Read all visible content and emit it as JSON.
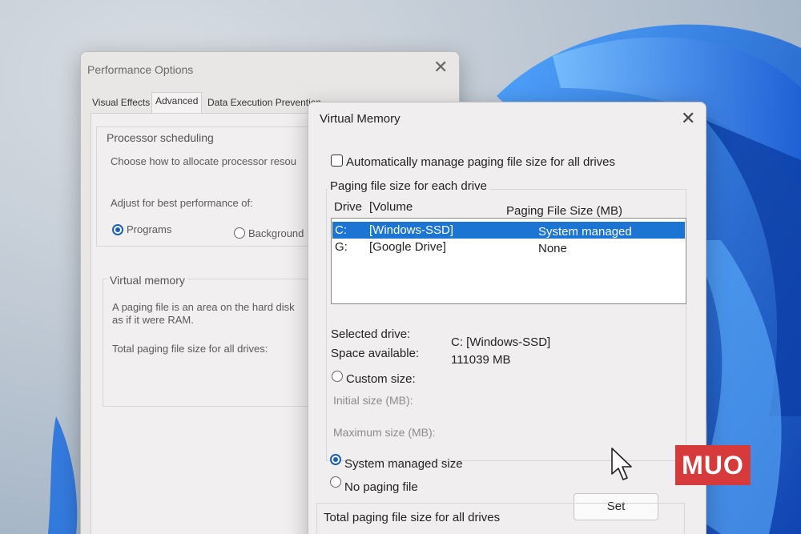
{
  "performance_options": {
    "title": "Performance Options",
    "tabs": [
      "Visual Effects",
      "Advanced",
      "Data Execution Prevention"
    ],
    "processor_scheduling": {
      "label": "Processor scheduling",
      "description": "Choose how to allocate processor resou",
      "adjust_label": "Adjust for best performance of:",
      "options": [
        "Programs",
        "Background"
      ],
      "selected": "Programs"
    },
    "virtual_memory": {
      "label": "Virtual memory",
      "description_line1": "A paging file is an area on the hard disk",
      "description_line2": "as if it were RAM.",
      "total_label": "Total paging file size for all drives:"
    }
  },
  "virtual_memory_dialog": {
    "title": "Virtual Memory",
    "auto_manage_label": "Automatically manage paging file size for all drives",
    "auto_manage_checked": false,
    "group_label": "Paging file size for each drive",
    "columns": {
      "drive": "Drive",
      "volume": "[Volume",
      "size": "Paging File Size (MB)"
    },
    "drives": [
      {
        "drive": "C:",
        "volume": "[Windows-SSD]",
        "size": "System managed",
        "selected": true
      },
      {
        "drive": "G:",
        "volume": "[Google Drive]",
        "size": "None",
        "selected": false
      }
    ],
    "selected_drive_label": "Selected drive:",
    "selected_drive_value": "C:  [Windows-SSD]",
    "space_available_label": "Space available:",
    "space_available_value": "111039 MB",
    "custom_size_label": "Custom size:",
    "initial_size_label": "Initial size (MB):",
    "maximum_size_label": "Maximum size (MB):",
    "system_managed_label": "System managed size",
    "no_paging_label": "No paging file",
    "selected_option": "System managed size",
    "set_button": "Set",
    "total_label": "Total paging file size for all drives"
  },
  "close_glyph": "✕",
  "watermark": "MUO",
  "colors": {
    "selection": "#1c74d3",
    "watermark_bg": "#d73a3a",
    "wallpaper_accent": "#1565d8"
  }
}
